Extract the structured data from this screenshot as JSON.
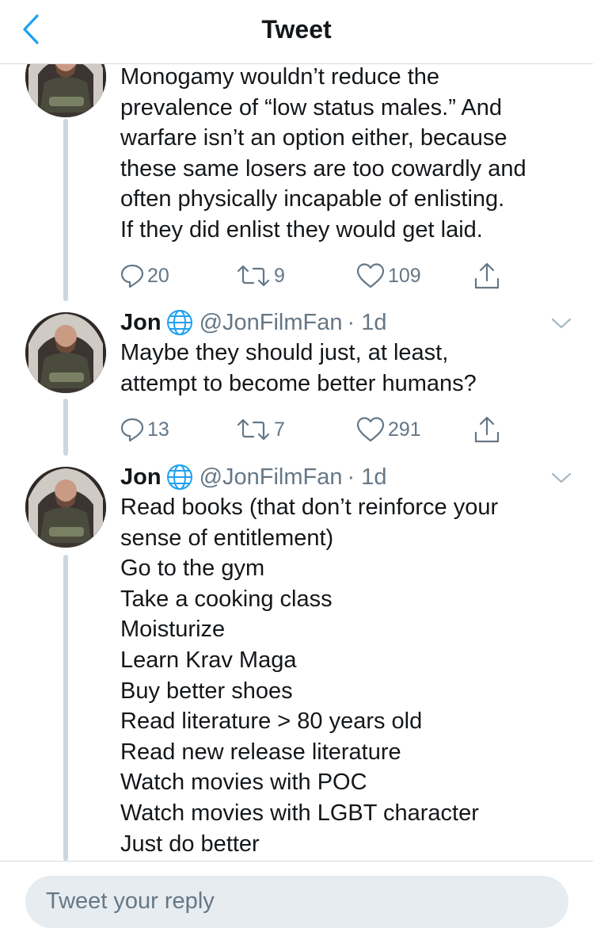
{
  "header": {
    "title": "Tweet"
  },
  "tweets": [
    {
      "text_lines": [
        "Monogamy wouldn’t reduce the",
        "prevalence of “low status males.” And",
        "warfare isn’t an option either, because",
        "these same losers are too cowardly and",
        "often physically incapable of enlisting.",
        "If they did enlist they would get laid."
      ],
      "replies": "20",
      "retweets": "9",
      "likes": "109"
    },
    {
      "name": "Jon",
      "handle": "@JonFilmFan",
      "time": "· 1d",
      "text_lines": [
        "Maybe they should just, at least,",
        "attempt to become better humans?"
      ],
      "replies": "13",
      "retweets": "7",
      "likes": "291"
    },
    {
      "name": "Jon",
      "handle": "@JonFilmFan",
      "time": "· 1d",
      "text_lines": [
        "Read books (that don’t reinforce your",
        "sense of entitlement)",
        "Go to the gym",
        "Take a cooking class",
        "Moisturize",
        "Learn Krav Maga",
        "Buy better shoes",
        "Read literature > 80 years old",
        "Read new release literature",
        "Watch movies with POC",
        "Watch movies with LGBT character",
        "Just do better"
      ]
    }
  ],
  "reply": {
    "placeholder": "Tweet your reply"
  },
  "colors": {
    "accent": "#1da1f2",
    "muted": "#657786",
    "thread_line": "#ccd6dd",
    "text": "#14171a"
  },
  "icons": [
    "back-chevron-icon",
    "globe-icon",
    "reply-icon",
    "retweet-icon",
    "like-icon",
    "share-icon",
    "caret-down-icon"
  ]
}
